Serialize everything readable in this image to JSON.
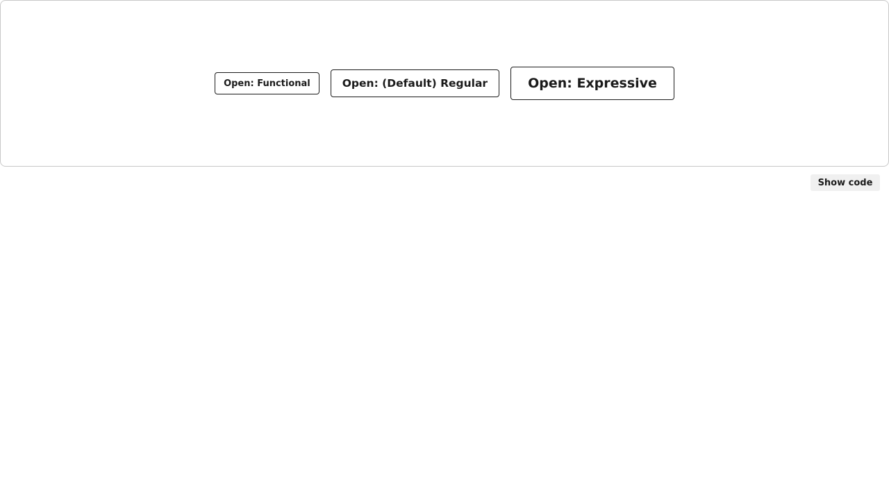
{
  "preview": {
    "buttons": [
      {
        "label": "Open: Functional",
        "variant": "functional"
      },
      {
        "label": "Open: (Default) Regular",
        "variant": "regular"
      },
      {
        "label": "Open: Expressive",
        "variant": "expressive"
      }
    ]
  },
  "toolbar": {
    "show_code_label": "Show code"
  },
  "colors": {
    "text": "#1a1a1a",
    "border": "#1a1a1a",
    "frame_border": "#c8c8c8",
    "show_code_bg": "#f0f0f0",
    "background": "#ffffff"
  }
}
